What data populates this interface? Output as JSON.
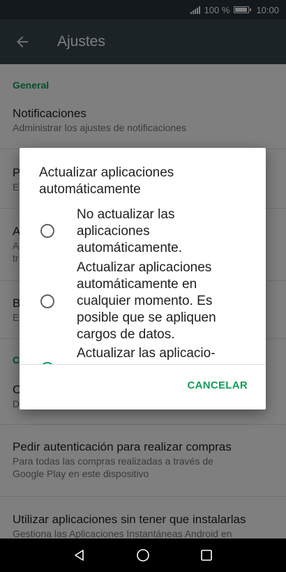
{
  "status_bar": {
    "battery": "100 %",
    "time": "10:00"
  },
  "app_bar": {
    "title": "Ajustes"
  },
  "settings": {
    "section_general": "General",
    "items": [
      {
        "title": "Notificaciones",
        "subtitle": "Administrar los ajustes de notificaciones"
      },
      {
        "title": "P",
        "subtitle": "E"
      },
      {
        "title": "A",
        "subtitle": "A",
        "subtitle2": "tr"
      },
      {
        "title": "B",
        "subtitle": "E"
      },
      {
        "title": "C",
        "subtitle": "D"
      },
      {
        "title": "Pedir autenticación para realizar compras",
        "subtitle": "Para todas las compras realizadas a través de",
        "subtitle2": "Google Play en este dispositivo"
      },
      {
        "title": "Utilizar aplicaciones sin tener que instalarlas",
        "subtitle": "Gestiona las Aplicaciones Instantáneas Android en"
      }
    ],
    "section_second": "C"
  },
  "dialog": {
    "title": "Actualizar aplicaciones automáticamente",
    "options": [
      {
        "label": "No actualizar las aplicaciones automáticamente.",
        "checked": false
      },
      {
        "label": "Actualizar aplicaciones automáticamente en cualquier momento. Es posible que se apliquen cargos de datos.",
        "checked": false
      },
      {
        "label": "Actualizar las aplicacio-",
        "checked": true
      }
    ],
    "cancel_label": "CANCELAR"
  },
  "colors": {
    "accent": "#0f9d58",
    "app_bar": "#37474f",
    "status_bar": "#27333a"
  },
  "nav_icons": [
    "back-triangle-icon",
    "home-circle-icon",
    "recents-square-icon"
  ]
}
